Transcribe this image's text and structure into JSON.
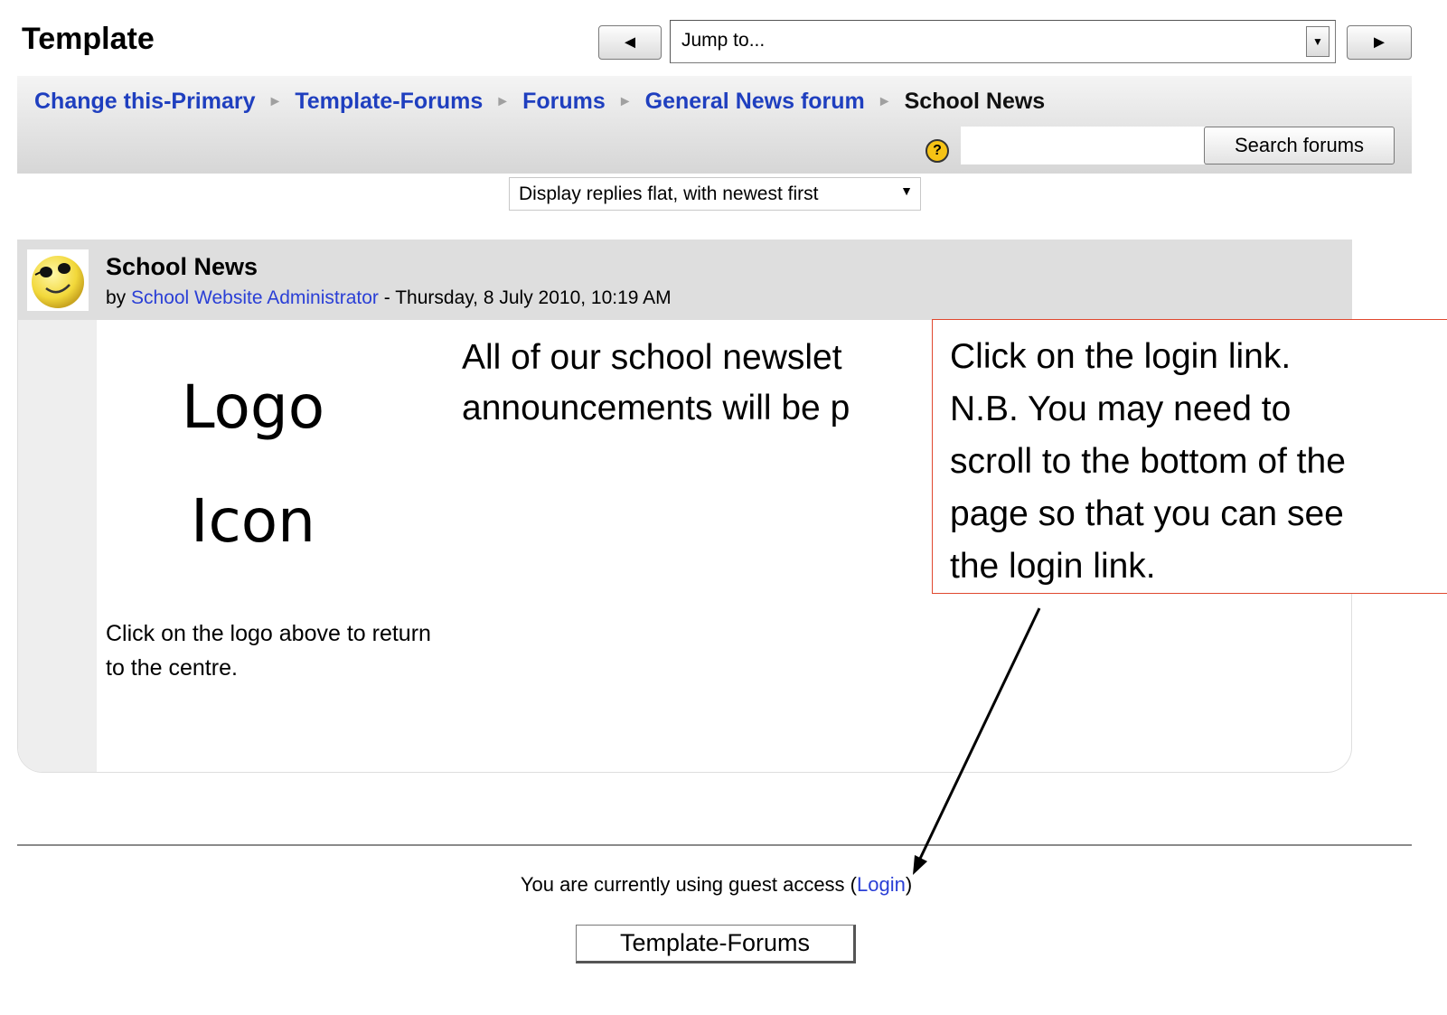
{
  "header": {
    "title": "Template",
    "jump_to": "Jump to...",
    "prev_glyph": "◄",
    "next_glyph": "►"
  },
  "breadcrumb": {
    "items": [
      "Change this-Primary",
      "Template-Forums",
      "Forums",
      "General News forum"
    ],
    "current": "School News"
  },
  "search": {
    "value": "",
    "button_label": "Search forums",
    "help_glyph": "?"
  },
  "display_mode": "Display replies flat, with newest first",
  "post": {
    "subject": "School News",
    "by_prefix": "by ",
    "author": "School Website Administrator",
    "date": " - Thursday, 8 July 2010, 10:19 AM",
    "logo_line1": "Logo",
    "logo_line2": "Icon",
    "logo_caption": "Click on the logo above to return to the centre.",
    "message_line1": "All of our school newslet",
    "message_line2": "announcements will be p"
  },
  "callout": {
    "lines": [
      "Click on the login link.",
      "N.B. You may need to",
      "scroll to the bottom of the",
      "page so that you can see",
      "the login link."
    ],
    "border_color": "#e0482f"
  },
  "footer": {
    "guest_prefix": "You are currently using guest access (",
    "login_link": "Login",
    "guest_suffix": ")",
    "back_button": "Template-Forums"
  },
  "colors": {
    "link": "#1f3fbf",
    "navbar_bg": "#d6d6d6"
  }
}
